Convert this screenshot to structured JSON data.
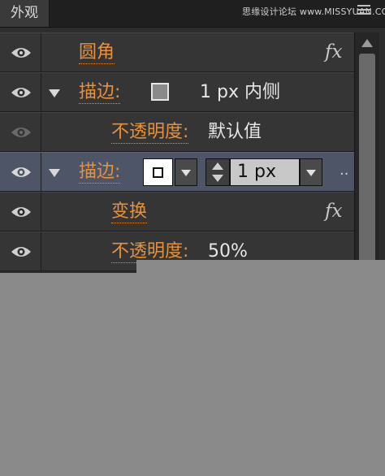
{
  "panel": {
    "tab_label": "外观",
    "watermark": "思缘设计论坛 www.MISSYUAN.COM"
  },
  "rows": [
    {
      "label": "圆角",
      "fx": "fx"
    },
    {
      "label": "描边:",
      "value": "1 px  内侧"
    },
    {
      "label": "不透明度:",
      "value": "默认值"
    },
    {
      "label": "描边:",
      "stroke_width": "1 px",
      "more": ".."
    },
    {
      "label": "变换",
      "fx": "fx"
    },
    {
      "label": "不透明度:",
      "value": "50%"
    }
  ],
  "colors": {
    "label_accent": "#e8913c",
    "selected_row": "#4e5566",
    "panel_bg": "#2d2d2d"
  }
}
